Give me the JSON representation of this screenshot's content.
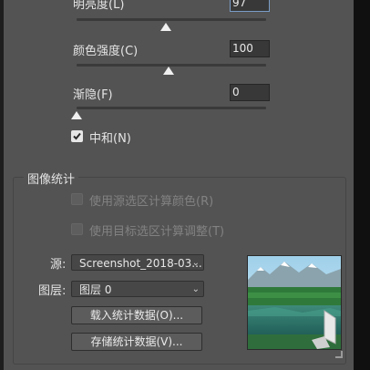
{
  "sliders": [
    {
      "label": "明亮度(L)",
      "value": "97"
    },
    {
      "label": "颜色强度(C)",
      "value": "100"
    },
    {
      "label": "渐隐(F)",
      "value": "0"
    }
  ],
  "neutralize": {
    "label": "中和(N)",
    "checked": true
  },
  "image_stats": {
    "title": "图像统计",
    "use_source_selection": "使用源选区计算颜色(R)",
    "use_target_selection": "使用目标选区计算调整(T)",
    "source_label": "源:",
    "source_value": "Screenshot_2018-03...",
    "layer_label": "图层:",
    "layer_value": "图层 0",
    "load_button": "载入统计数据(O)...",
    "save_button": "存储统计数据(V)..."
  }
}
